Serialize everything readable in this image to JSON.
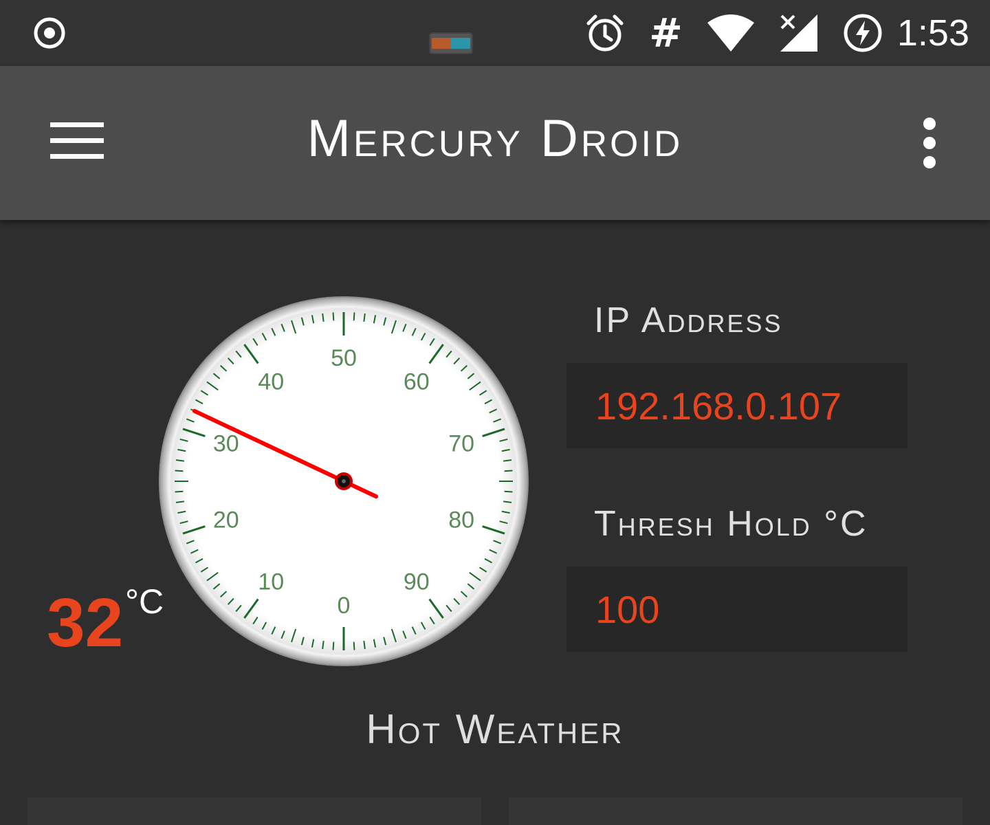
{
  "status_bar": {
    "time": "1:53",
    "hash_symbol": "#",
    "icons": [
      "target-icon",
      "battery-widget-icon",
      "alarm-icon",
      "wifi-icon",
      "no-signal-icon",
      "battery-charging-icon"
    ]
  },
  "app_bar": {
    "title": "Mercury Droid",
    "menu_icon": "hamburger-menu-icon",
    "overflow_icon": "overflow-dots-icon"
  },
  "gauge": {
    "min": 0,
    "max": 100,
    "value": 32,
    "labels": [
      "0",
      "10",
      "20",
      "30",
      "40",
      "50",
      "60",
      "70",
      "80",
      "90"
    ],
    "needle_color": "#ff0000",
    "tick_color": "#1a6a2a",
    "label_color": "#5a8a5a"
  },
  "reading": {
    "value": "32",
    "unit": "°C"
  },
  "ip_section": {
    "label": "IP Address",
    "value": "192.168.0.107"
  },
  "threshold_section": {
    "label": "Thresh Hold °C",
    "value": "100"
  },
  "weather_status": "Hot Weather",
  "colors": {
    "accent": "#e8441e",
    "background": "#2e2e2e",
    "app_bar": "#4c4c4c",
    "field_background": "#272727"
  }
}
